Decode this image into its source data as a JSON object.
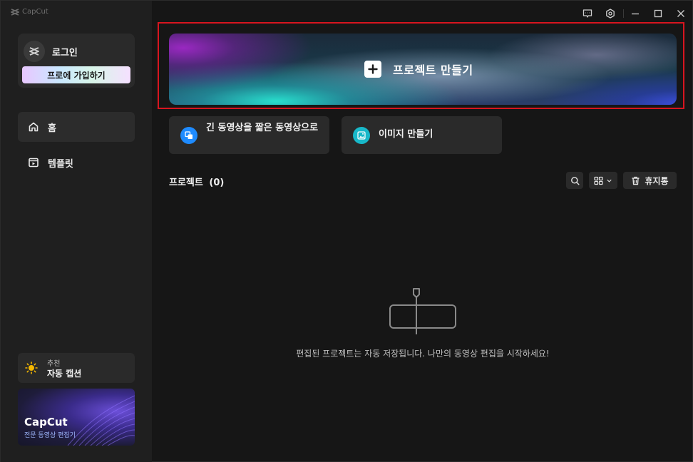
{
  "app": {
    "name": "CapCut"
  },
  "sidebar": {
    "login_label": "로그인",
    "pro_button": "프로에 가입하기",
    "nav": [
      {
        "label": "홈",
        "icon": "home-icon",
        "active": true
      },
      {
        "label": "템플릿",
        "icon": "template-icon",
        "active": false
      }
    ],
    "promo": {
      "small": "추천",
      "big": "자동 캡션",
      "icon": "sun-icon"
    },
    "banner": {
      "title": "CapCut",
      "subtitle": "전문 동영상 편집기"
    }
  },
  "titlebar": {
    "icons": [
      "feedback-icon",
      "settings-icon",
      "minimize-icon",
      "maximize-icon",
      "close-icon"
    ]
  },
  "main": {
    "create_project": "프로젝트 만들기",
    "cards": [
      {
        "label": "긴 동영상을 짧은 동영상으로",
        "icon": "long-to-short-icon",
        "color": "#1e8bff"
      },
      {
        "label": "이미지 만들기",
        "icon": "image-icon",
        "color": "#18b8c9"
      }
    ],
    "projects_label": "프로젝트",
    "projects_count": "(0)",
    "trash_label": "휴지통",
    "empty_message": "편집된 프로젝트는 자동 저장됩니다. 나만의 동영상 편집을 시작하세요!"
  },
  "colors": {
    "highlight": "#d8151f",
    "background": "#161616",
    "sidebar": "#1f1f1f",
    "card": "#2a2a2a"
  }
}
